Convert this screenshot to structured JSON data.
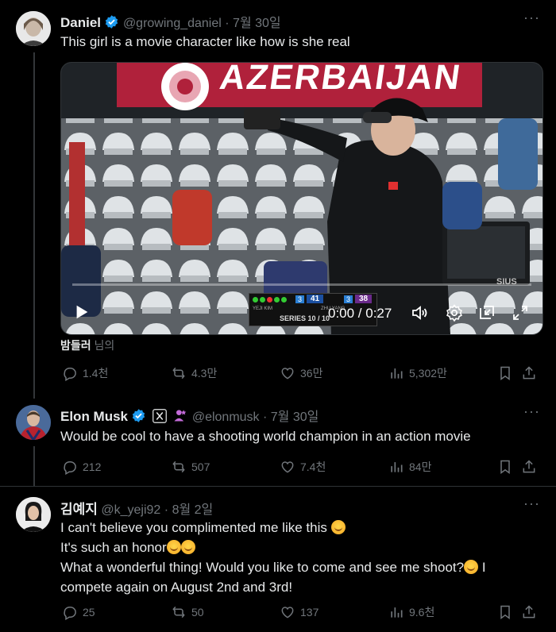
{
  "tweets": [
    {
      "name": "Daniel",
      "handle": "@growing_daniel",
      "sep": "·",
      "date": "7월 30일",
      "text": "This girl is a movie character like how is she real",
      "video": {
        "banner_text": "AZERBAIJAN",
        "time": "0:00 / 0:27",
        "scoreboard": {
          "left_score": "41",
          "right_score": "38",
          "left_rank": "3",
          "right_rank": "3",
          "series": "SERIES 10 / 10",
          "left_name": "YEJI KIM",
          "right_name": "ZHU YANG"
        },
        "monitor_brand": "SIUS"
      },
      "credit_name": "밤들러",
      "credit_suffix": " 님의",
      "stats": {
        "replies": "1.4천",
        "reposts": "4.3만",
        "likes": "36만",
        "views": "5,302만"
      }
    },
    {
      "name": "Elon Musk",
      "handle": "@elonmusk",
      "sep": "·",
      "date": "7월 30일",
      "text": "Would be cool to have a shooting world champion in an action movie",
      "stats": {
        "replies": "212",
        "reposts": "507",
        "likes": "7.4천",
        "views": "84만"
      }
    },
    {
      "name": "김예지",
      "handle": "@k_yeji92",
      "sep": "·",
      "date": "8월 2일",
      "lines": [
        "I can't believe you complimented me like this",
        "It's such an honor",
        "What a wonderful thing! Would you like to come and see me shoot?",
        "I",
        "compete again on August 2nd and 3rd!"
      ],
      "stats": {
        "replies": "25",
        "reposts": "50",
        "likes": "137",
        "views": "9.6천"
      }
    }
  ],
  "icons": [
    "more-icon",
    "verified-icon",
    "reply-icon",
    "repost-icon",
    "like-icon",
    "views-icon",
    "bookmark-icon",
    "share-icon",
    "play-icon",
    "volume-icon",
    "settings-icon",
    "pip-icon",
    "fullscreen-icon",
    "x-badge-icon",
    "affiliate-icon"
  ],
  "colors": {
    "background": "#000000",
    "text": "#e7e9ea",
    "muted": "#71767b",
    "verified": "#1d9bf0",
    "divider": "#2f3336"
  }
}
